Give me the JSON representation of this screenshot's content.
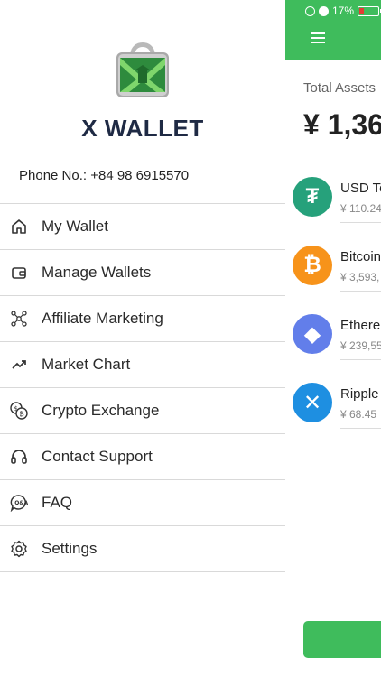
{
  "status_bar": {
    "battery": "17%"
  },
  "drawer": {
    "app_title": "X WALLET",
    "phone": "Phone No.: +84 98 6915570",
    "menu": [
      {
        "label": "My Wallet",
        "icon": "home-icon"
      },
      {
        "label": "Manage Wallets",
        "icon": "wallet-icon"
      },
      {
        "label": "Affiliate Marketing",
        "icon": "affiliate-network-icon"
      },
      {
        "label": "Market Chart",
        "icon": "trending-up-icon"
      },
      {
        "label": "Crypto Exchange",
        "icon": "coins-exchange-icon"
      },
      {
        "label": "Contact Support",
        "icon": "headset-icon"
      },
      {
        "label": "FAQ",
        "icon": "qa-chat-icon"
      },
      {
        "label": "Settings",
        "icon": "gear-icon"
      }
    ]
  },
  "main": {
    "total_label": "Total Assets",
    "total_value": "¥ 1,36",
    "assets": [
      {
        "name": "USD Te",
        "fiat": "¥ 110.24",
        "color": "#26a17b",
        "symbol": "₮"
      },
      {
        "name": "Bitcoin",
        "fiat": "¥ 3,593,",
        "color": "#f7931a",
        "symbol": "₿"
      },
      {
        "name": "Ethere",
        "fiat": "¥ 239,55",
        "color": "#627eea",
        "symbol": "◆"
      },
      {
        "name": "Ripple",
        "fiat": "¥ 68.45",
        "color": "#1e8fe1",
        "symbol": "✕"
      }
    ]
  },
  "colors": {
    "brand_green": "#3fbc5c",
    "title_navy": "#1f2a44"
  }
}
